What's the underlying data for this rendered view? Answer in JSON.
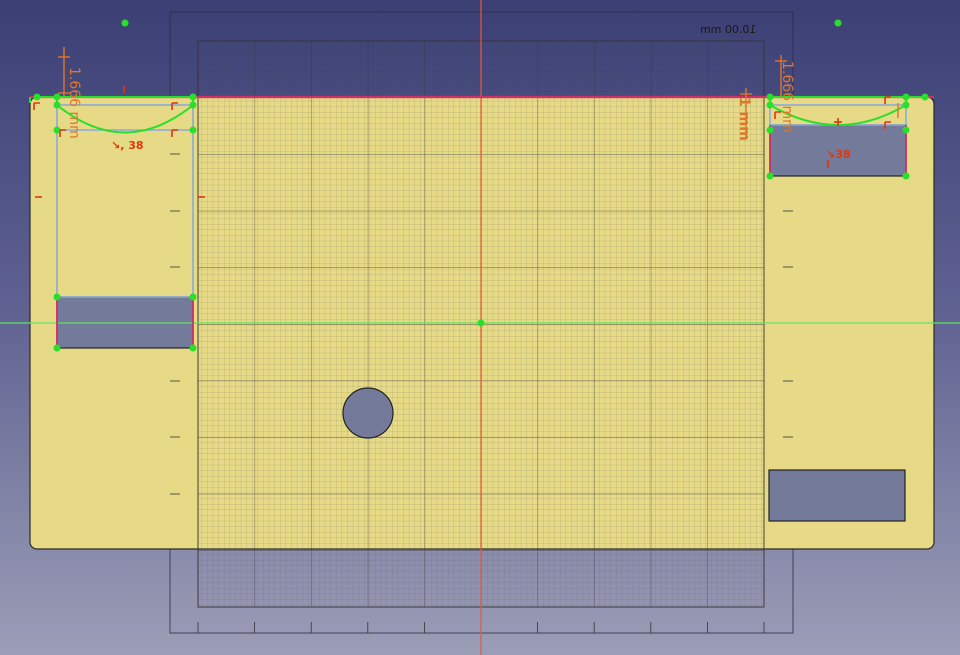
{
  "grid_label": "10.00 mm",
  "constraint_labels": {
    "left_radius": "38",
    "right_radius": "38"
  },
  "dimension_labels": {
    "left_vertical": "1.666 mm",
    "right_vertical_a": "1.666 mm",
    "right_vertical_b": "1 mm"
  },
  "colors": {
    "background_top": "#3b3f74",
    "background_bottom": "#9c9db6",
    "plate_fill": "#e6da86",
    "edge_magenta": "#d0306a",
    "sketch_green": "#28e02a",
    "construction_blue": "#8aaad8",
    "axis_red": "#e25a3a",
    "axis_green": "#5fe55f",
    "pocket_fill": "#747a9a",
    "dimension_orange": "#e0762a"
  }
}
